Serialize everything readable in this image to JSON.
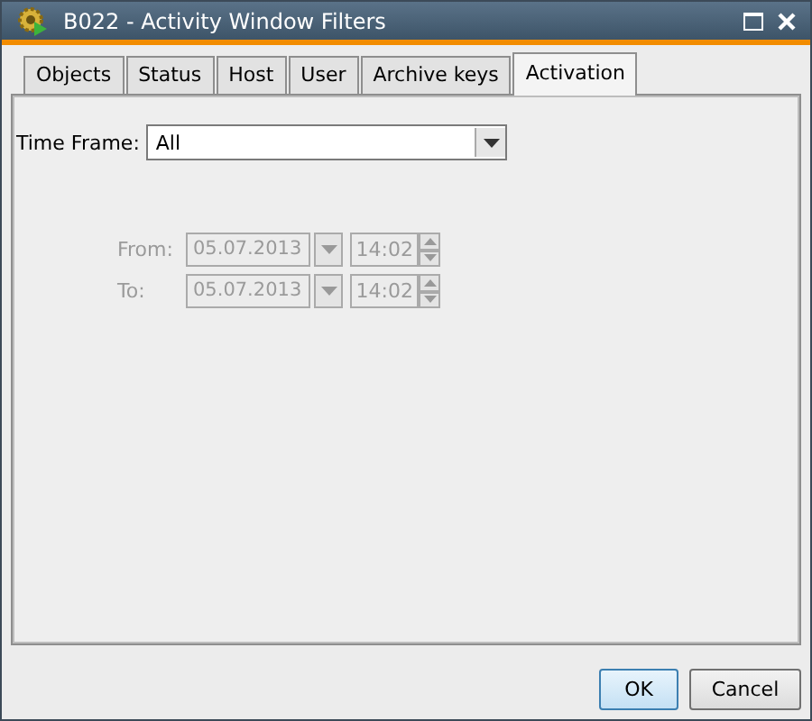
{
  "window": {
    "title": "B022 - Activity Window Filters"
  },
  "tabs": [
    {
      "label": "Objects",
      "selected": false
    },
    {
      "label": "Status",
      "selected": false
    },
    {
      "label": "Host",
      "selected": false
    },
    {
      "label": "User",
      "selected": false
    },
    {
      "label": "Archive keys",
      "selected": false
    },
    {
      "label": "Activation",
      "selected": true
    }
  ],
  "time_frame": {
    "label": "Time Frame:",
    "value": "All"
  },
  "range": [
    {
      "label": "From:",
      "date": "05.07.2013",
      "time": "14:02",
      "disabled": true
    },
    {
      "label": "To:",
      "date": "05.07.2013",
      "time": "14:02",
      "disabled": true
    }
  ],
  "buttons": [
    {
      "label": "OK",
      "default": true
    },
    {
      "label": "Cancel",
      "default": false
    }
  ]
}
